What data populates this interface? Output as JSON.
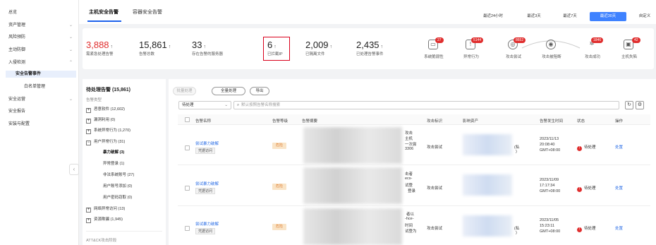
{
  "sidebar": {
    "items": [
      {
        "label": "总览",
        "chevron": false
      },
      {
        "label": "资产管理",
        "chevron": true
      },
      {
        "label": "风险预防",
        "chevron": true
      },
      {
        "label": "主动防御",
        "chevron": true
      },
      {
        "label": "入侵检测",
        "chevron": true,
        "expanded": true
      }
    ],
    "subitems": [
      {
        "label": "安全告警事件",
        "active": true
      },
      {
        "label": "白名单管理",
        "active": false
      }
    ],
    "items_after": [
      {
        "label": "安全运营",
        "chevron": true
      },
      {
        "label": "安全报告",
        "chevron": false
      },
      {
        "label": "安装与配置",
        "chevron": false
      }
    ],
    "collapse_icon": "chevron-left-icon"
  },
  "header": {
    "tabs": [
      {
        "label": "主机安全告警",
        "active": true
      },
      {
        "label": "容器安全告警",
        "active": false
      }
    ],
    "time_ranges": [
      {
        "label": "最近24小时",
        "active": false
      },
      {
        "label": "最近3天",
        "active": false
      },
      {
        "label": "最近7天",
        "active": false
      },
      {
        "label": "最近30天",
        "active": true
      },
      {
        "label": "自定义",
        "active": false
      }
    ]
  },
  "stats": [
    {
      "value": "3,888",
      "arrow": "↑",
      "label": "需紧急处理告警",
      "red": true
    },
    {
      "value": "15,861",
      "arrow": "↑",
      "label": "告警总数",
      "red": false
    },
    {
      "value": "33",
      "arrow": "↑",
      "label": "存在告警的服务器",
      "red": false
    },
    {
      "value": "6",
      "arrow": "↑",
      "label": "已拦截IP",
      "red": false
    },
    {
      "value": "2,009",
      "arrow": "↑",
      "label": "已隔离文件",
      "red": false
    },
    {
      "value": "2,435",
      "arrow": "↑",
      "label": "已处理告警事件",
      "red": false
    }
  ],
  "stages": [
    {
      "label": "系统脆弱性",
      "badge": "27",
      "icon": "monitor-icon"
    },
    {
      "label": "异常行为",
      "badge": "5144",
      "icon": "alert-window-icon"
    },
    {
      "label": "攻击尝试",
      "badge": "8652",
      "icon": "target-icon"
    },
    {
      "label": "攻击被阻断",
      "badge": "",
      "icon": "shield-icon"
    },
    {
      "label": "攻击成功",
      "badge": "1846",
      "icon": "bug-icon"
    },
    {
      "label": "主机失陷",
      "badge": "42",
      "icon": "host-icon"
    }
  ],
  "filter": {
    "title": "待处理告警 (15,861)",
    "subtitle": "告警类型",
    "categories": [
      {
        "label": "恶意软件 (12,602)",
        "mark": "+"
      },
      {
        "label": "漏洞利用 (0)",
        "mark": "+"
      },
      {
        "label": "系统异常行为 (1,270)",
        "mark": "+"
      },
      {
        "label": "用户异常行为 (31)",
        "mark": "−"
      }
    ],
    "children": [
      {
        "label": "暴力破解 (3)",
        "active": true
      },
      {
        "label": "异常登录 (1)",
        "active": false
      },
      {
        "label": "非法系统账号 (27)",
        "active": false
      },
      {
        "label": "用户账号添加 (0)",
        "active": false
      },
      {
        "label": "用户密码窃取 (0)",
        "active": false
      }
    ],
    "categories_after": [
      {
        "label": "网络异常访问 (13)",
        "mark": "+"
      },
      {
        "label": "资源欺骗 (1,945)",
        "mark": "+"
      }
    ],
    "footer": "ATT&CK攻击阶段"
  },
  "toolbar": {
    "batch_label": "批量处理",
    "all_label": "全量处理",
    "export_label": "导出",
    "status_select": "待处理",
    "search_placeholder": "默认按照告警名称搜索",
    "refresh_icon": "refresh-icon",
    "settings_icon": "gear-icon"
  },
  "table": {
    "columns": [
      "告警名称",
      "告警等级",
      "告警摘要",
      "攻击标识",
      "影响资产",
      "告警发生时间",
      "状态",
      "操作"
    ],
    "rows": [
      {
        "name": "尝试暴力破解",
        "tag": "凭据访问",
        "level": "危险",
        "summary_tail": [
          "攻击",
          "主机",
          "一次尝",
          "3306"
        ],
        "attack": "攻击尝试",
        "asset_tail": "(私",
        "asset_tail2": ")",
        "time": [
          "2023/11/13",
          "20:08:40",
          "GMT+08:00"
        ],
        "status": "待处理",
        "action": "处置"
      },
      {
        "name": "尝试暴力破解",
        "tag": "凭据访问",
        "level": "危险",
        "summary_tail": [
          "击者",
          "ecs-",
          "试登",
          "登录"
        ],
        "attack": "攻击尝试",
        "asset_tail": "",
        "asset_tail2": "",
        "time": [
          "2023/11/09",
          "17:17:34",
          "GMT+08:00"
        ],
        "status": "待处理",
        "action": "处置"
      },
      {
        "name": "尝试暴力破解",
        "tag": "凭据访问",
        "level": "危险",
        "summary_tail": [
          "者以",
          "-hce-",
          "时间",
          "试登为"
        ],
        "attack": "攻击尝试",
        "asset_tail": "(私",
        "asset_tail2": ")",
        "time": [
          "2023/11/05",
          "15:23:11",
          "GMT+08:00"
        ],
        "status": "待处理",
        "action": "处置"
      }
    ]
  },
  "colors": {
    "accent": "#1e62ec",
    "danger": "#e02e2e",
    "warning_bg": "#f9e4c7"
  }
}
